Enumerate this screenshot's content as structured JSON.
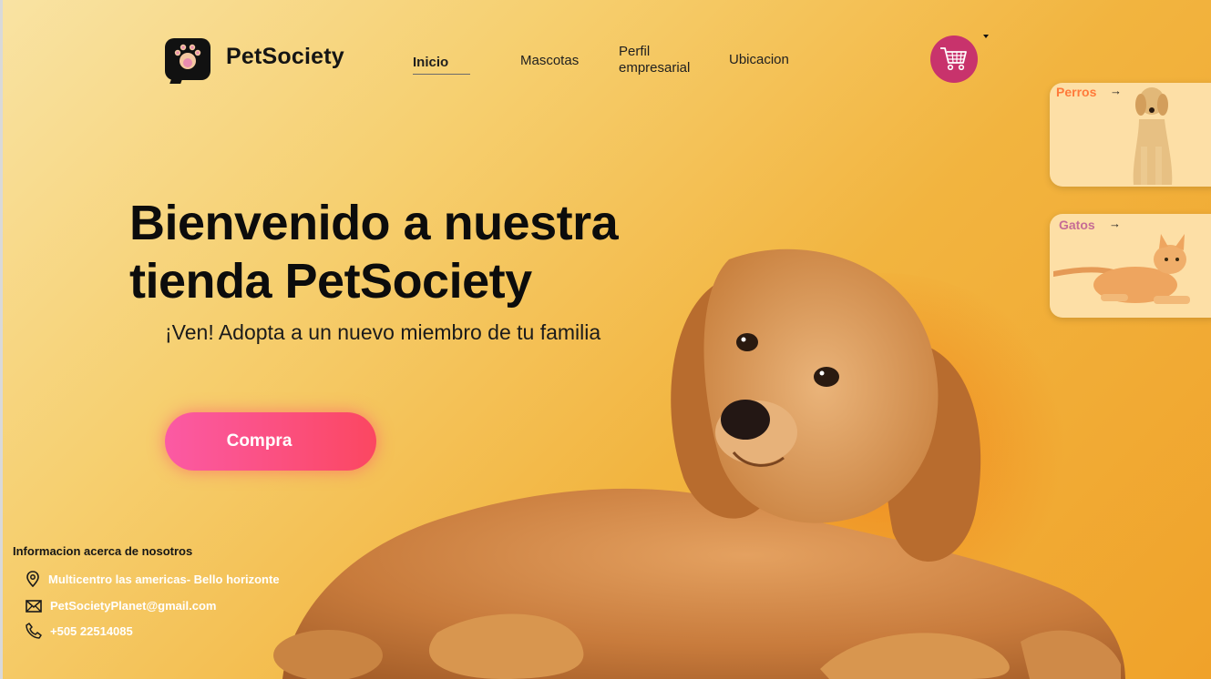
{
  "header": {
    "brand": "PetSociety",
    "nav": {
      "inicio": "Inicio",
      "mascotas": "Mascotas",
      "perfil": "Perfil empresarial",
      "ubicacion": "Ubicacion"
    },
    "cart_icon": "shopping-cart-icon"
  },
  "hero": {
    "title": "Bienvenido a nuestra tienda PetSociety",
    "subtitle": "¡Ven! Adopta a un nuevo miembro de tu familia",
    "button_label": "Compra"
  },
  "categories": [
    {
      "label": "Perros",
      "arrow": "→"
    },
    {
      "label": "Gatos",
      "arrow": "→"
    }
  ],
  "info": {
    "title": "Informacion acerca de nosotros",
    "address": "Multicentro las americas- Bello horizonte",
    "email": "PetSocietyPlanet@gmail.com",
    "phone": "+505 22514085"
  },
  "colors": {
    "accent_pink": "#fb5aa4",
    "accent_red": "#fb4761",
    "cart_bg": "#c8336c",
    "background_orange": "#f2b43f"
  }
}
